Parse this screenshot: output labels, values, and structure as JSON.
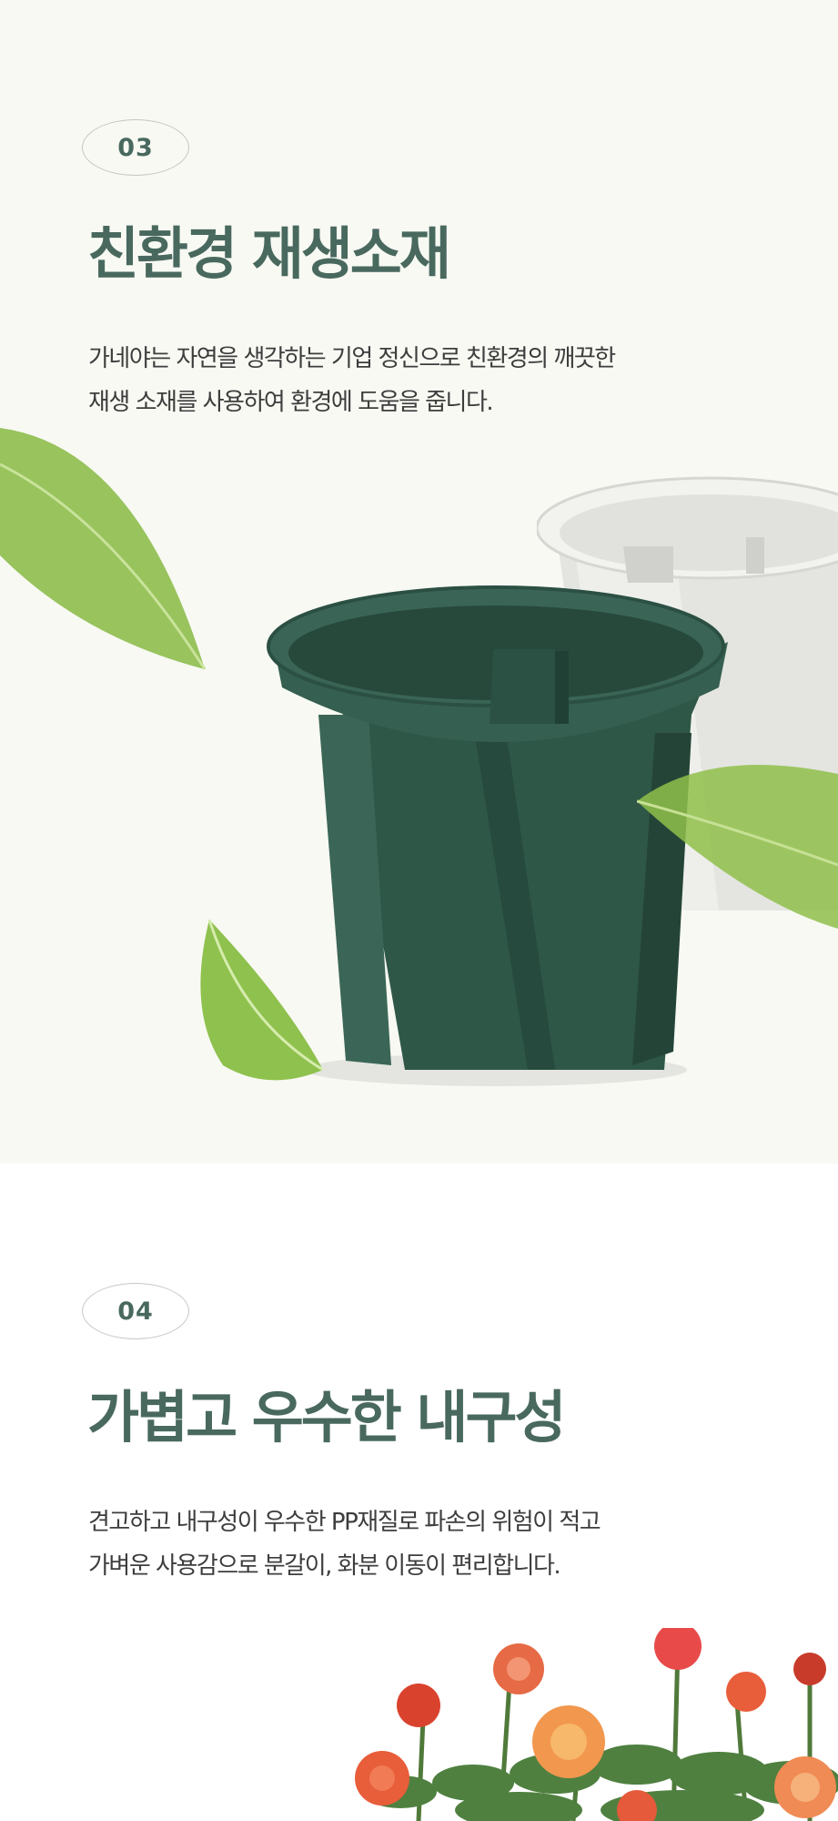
{
  "section_03": {
    "badge": "03",
    "title": "친환경 재생소재",
    "lines": [
      "가네야는 자연을 생각하는 기업 정신으로 친환경의 깨끗한",
      "재생 소재를 사용하여 환경에 도움을 줍니다."
    ]
  },
  "section_04": {
    "badge": "04",
    "title": "가볍고 우수한 내구성",
    "lines": [
      "견고하고 내구성이 우수한 PP재질로 파손의 위험이 적고",
      "가벼운 사용감으로 분갈이, 화분 이동이 편리합니다."
    ]
  },
  "colors": {
    "accent": "#49695f",
    "pot_green": "#2f5748",
    "pot_white": "#e9eae6",
    "leaf": "#8fbf4a",
    "rose": "#e8623c"
  }
}
